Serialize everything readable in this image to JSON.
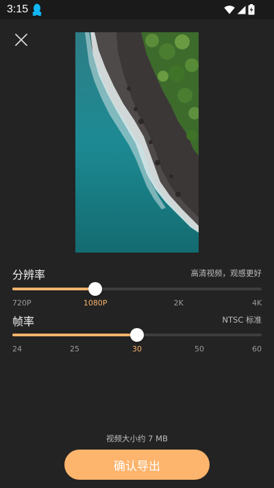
{
  "status_bar": {
    "time": "3:15",
    "left_icons": [
      "qq-icon"
    ],
    "right_icons": [
      "wifi-icon",
      "signal-icon",
      "battery-icon"
    ]
  },
  "close_button": {
    "icon": "close-icon"
  },
  "resolution": {
    "title": "分辨率",
    "description": "高清视频，观感更好",
    "options": [
      "720P",
      "1080P",
      "2K",
      "4K"
    ],
    "selected": "1080P",
    "selected_index": 1,
    "value_fraction": 0.333
  },
  "frame_rate": {
    "title": "帧率",
    "description": "NTSC 标准",
    "options": [
      "24",
      "25",
      "30",
      "50",
      "60"
    ],
    "selected": "30",
    "selected_index": 2,
    "value_fraction": 0.5
  },
  "file_size_text": "视频大小约 7 MB",
  "export_button_label": "确认导出",
  "colors": {
    "background": "#232323",
    "accent": "#fdb46c",
    "track": "#3e3e3e",
    "thumb": "#ffffff"
  }
}
